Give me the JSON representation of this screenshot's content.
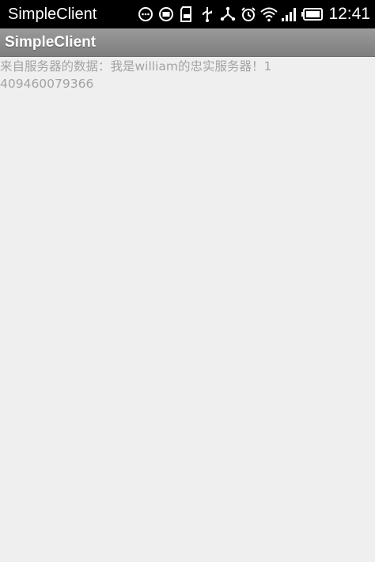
{
  "status_bar": {
    "app_name": "SimpleClient",
    "time": "12:41",
    "icons": [
      "chat-icon",
      "message-icon",
      "sd-card-icon",
      "usb-icon",
      "share-icon",
      "alarm-icon",
      "wifi-icon",
      "signal-icon",
      "battery-icon"
    ],
    "colors": {
      "background": "#000000",
      "text": "#ffffff"
    }
  },
  "action_bar": {
    "title": "SimpleClient"
  },
  "main": {
    "message": "来自服务器的数据：我是william的忠实服务器！1409460079366"
  }
}
